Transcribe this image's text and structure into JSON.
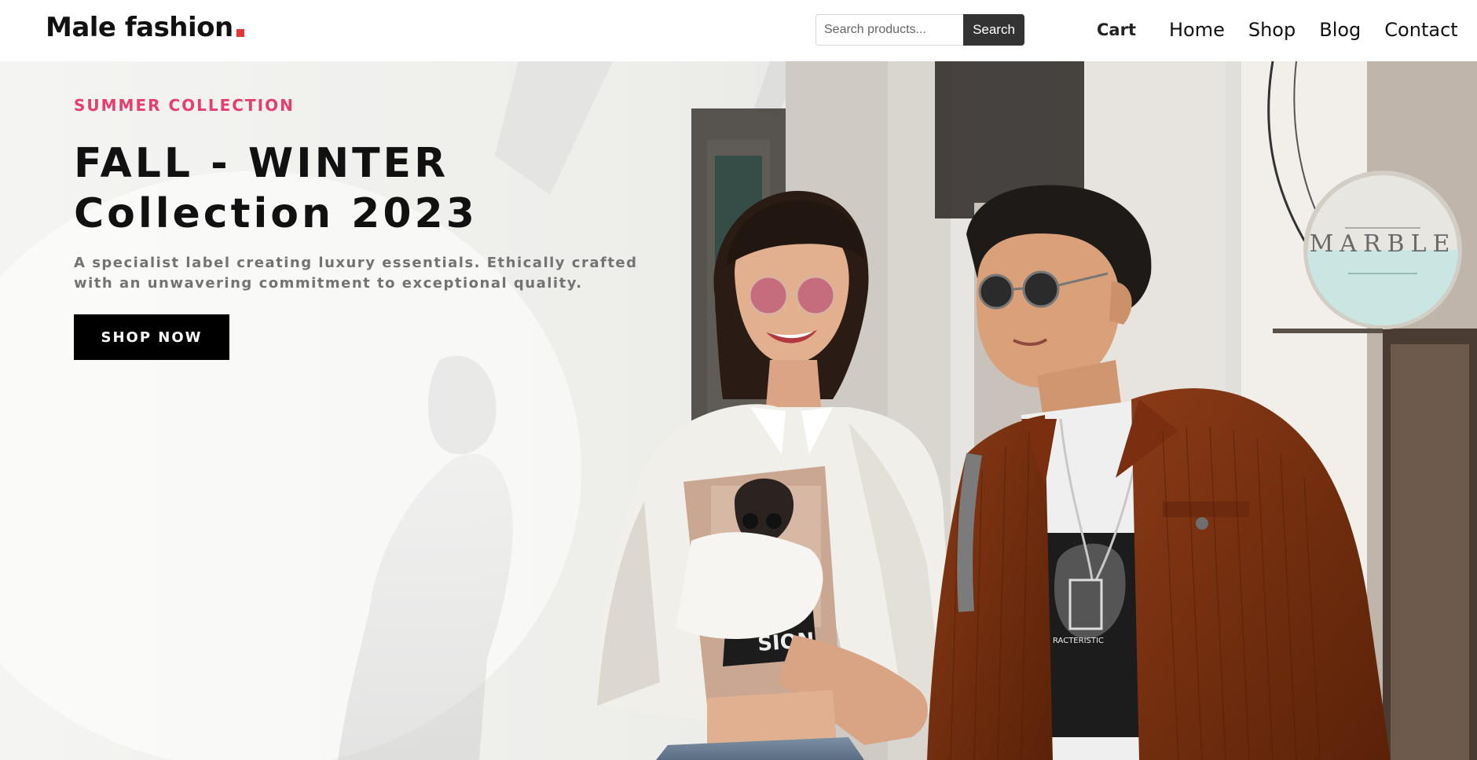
{
  "header": {
    "logo_text": "Male fashion",
    "search_placeholder": "Search products...",
    "search_button": "Search",
    "cart_label": "Cart",
    "nav": [
      "Home",
      "Shop",
      "Blog",
      "Contact"
    ],
    "logo_accent_color": "#e53637"
  },
  "hero": {
    "tagline": "SUMMER COLLECTION",
    "title_line1": "FALL - WINTER",
    "title_line2": "Collection 2023",
    "description": "A specialist label creating luxury essentials. Ethically crafted with an unwavering commitment to exceptional quality.",
    "cta_label": "SHOP NOW",
    "shop_sign_text": "MARBLE",
    "tagline_color": "#e53e6f"
  }
}
